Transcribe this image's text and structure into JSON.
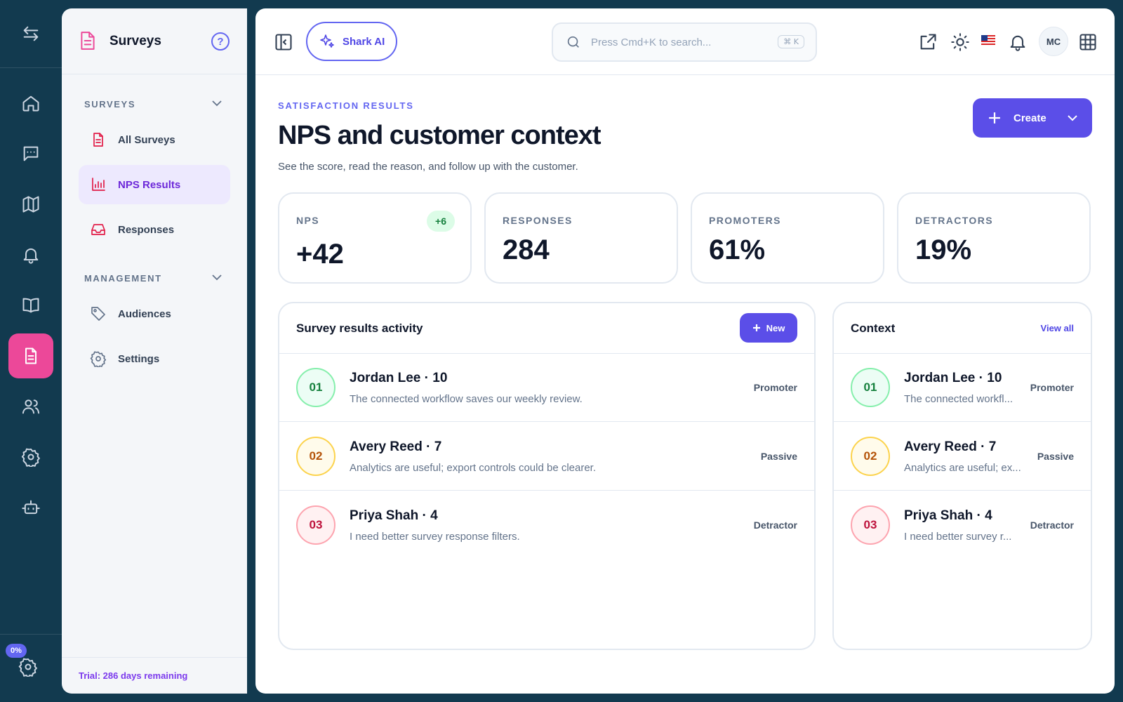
{
  "sidebar": {
    "title": "Surveys",
    "help_glyph": "?",
    "sections": [
      {
        "label": "SURVEYS"
      },
      {
        "label": "MANAGEMENT"
      }
    ],
    "items": [
      {
        "label": "All Surveys",
        "icon": "document-icon"
      },
      {
        "label": "NPS Results",
        "icon": "bar-chart-icon",
        "active": true
      },
      {
        "label": "Responses",
        "icon": "inbox-icon"
      },
      {
        "label": "Audiences",
        "icon": "tag-icon"
      },
      {
        "label": "Settings",
        "icon": "gear-icon"
      }
    ],
    "trial": "Trial: 286 days remaining"
  },
  "rail": {
    "progress_badge": "0%",
    "icons": [
      "swap-arrows-icon",
      "home-icon",
      "chat-icon",
      "map-icon",
      "bell-icon",
      "book-icon",
      "document-icon",
      "users-icon",
      "gear-icon",
      "robot-icon",
      "gear-icon"
    ],
    "active_index": 6,
    "active_color": "#ec4899"
  },
  "topbar": {
    "ai_label": "Shark AI",
    "search_placeholder": "Press Cmd+K to search...",
    "shortcut": "⌘ K",
    "avatar_initials": "MC",
    "icons": [
      "panel-collapse-icon",
      "sparkles-icon",
      "search-icon",
      "external-link-icon",
      "sun-icon",
      "us-flag-icon",
      "bell-icon",
      "grid-icon"
    ]
  },
  "header": {
    "eyebrow": "SATISFACTION RESULTS",
    "title": "NPS and customer context",
    "subtitle": "See the score, read the reason, and follow up with the customer.",
    "create_label": "Create"
  },
  "stats": [
    {
      "label": "NPS",
      "value": "+42",
      "delta": "+6"
    },
    {
      "label": "RESPONSES",
      "value": "284"
    },
    {
      "label": "PROMOTERS",
      "value": "61%"
    },
    {
      "label": "DETRACTORS",
      "value": "19%"
    }
  ],
  "activity": {
    "title": "Survey results activity",
    "new_label": "New",
    "rows": [
      {
        "num": "01",
        "name": "Jordan Lee · 10",
        "text": "The connected workflow saves our weekly review.",
        "tag": "Promoter"
      },
      {
        "num": "02",
        "name": "Avery Reed · 7",
        "text": "Analytics are useful; export controls could be clearer.",
        "tag": "Passive"
      },
      {
        "num": "03",
        "name": "Priya Shah · 4",
        "text": "I need better survey response filters.",
        "tag": "Detractor"
      }
    ]
  },
  "context": {
    "title": "Context",
    "view_all_label": "View all",
    "rows": [
      {
        "num": "01",
        "name": "Jordan Lee · 10",
        "text": "The connected workfl...",
        "tag": "Promoter"
      },
      {
        "num": "02",
        "name": "Avery Reed · 7",
        "text": "Analytics are useful; ex...",
        "tag": "Passive"
      },
      {
        "num": "03",
        "name": "Priya Shah · 4",
        "text": "I need better survey r...",
        "tag": "Detractor"
      }
    ]
  },
  "colors": {
    "rail_bg": "#123a4f",
    "accent": "#5b4ee8",
    "pink": "#ec4899",
    "promoter": "#15803d",
    "passive": "#b45309",
    "detractor": "#be123c"
  }
}
